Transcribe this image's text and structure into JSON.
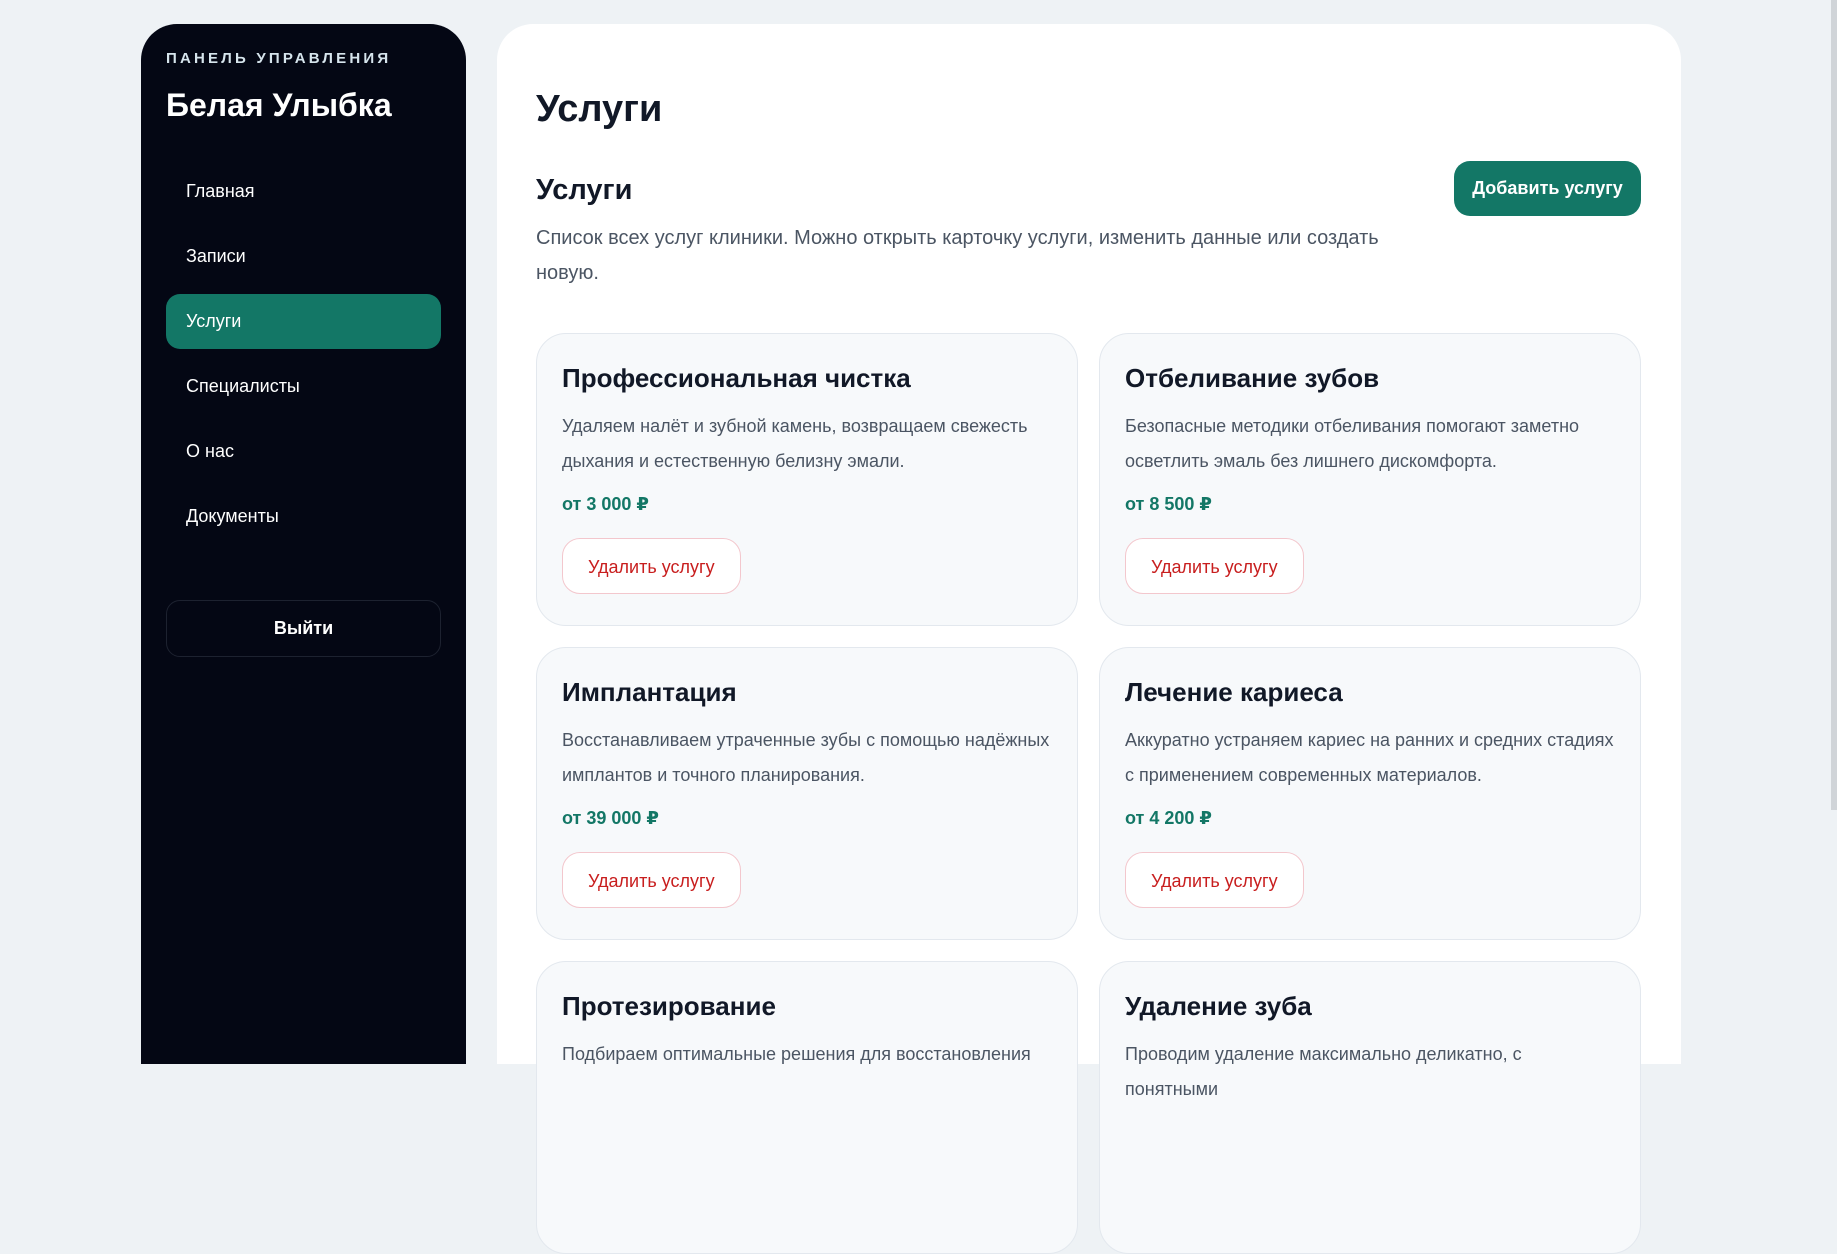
{
  "sidebar": {
    "kicker": "ПАНЕЛЬ УПРАВЛЕНИЯ",
    "brand": "Белая Улыбка",
    "items": [
      {
        "label": "Главная",
        "active": false
      },
      {
        "label": "Записи",
        "active": false
      },
      {
        "label": "Услуги",
        "active": true
      },
      {
        "label": "Специалисты",
        "active": false
      },
      {
        "label": "О нас",
        "active": false
      },
      {
        "label": "Документы",
        "active": false
      }
    ],
    "logout_label": "Выйти"
  },
  "main": {
    "page_title": "Услуги",
    "section_title": "Услуги",
    "section_desc": "Список всех услуг клиники. Можно открыть карточку услуги, изменить данные или создать новую.",
    "add_button": "Добавить услугу"
  },
  "services": [
    {
      "title": "Профессиональная чистка",
      "desc": "Удаляем налёт и зубной камень, возвращаем свежесть дыхания и естественную белизну эмали.",
      "price": "от 3 000 ₽",
      "delete_label": "Удалить услугу"
    },
    {
      "title": "Отбеливание зубов",
      "desc": "Безопасные методики отбеливания помогают заметно осветлить эмаль без лишнего дискомфорта.",
      "price": "от 8 500 ₽",
      "delete_label": "Удалить услугу"
    },
    {
      "title": "Имплантация",
      "desc": "Восстанавливаем утраченные зубы с помощью надёжных имплантов и точного планирования.",
      "price": "от 39 000 ₽",
      "delete_label": "Удалить услугу"
    },
    {
      "title": "Лечение кариеса",
      "desc": "Аккуратно устраняем кариес на ранних и средних стадиях с применением современных материалов.",
      "price": "от 4 200 ₽",
      "delete_label": "Удалить услугу"
    },
    {
      "title": "Протезирование",
      "desc": "Подбираем оптимальные решения для восстановления",
      "price": "",
      "delete_label": ""
    },
    {
      "title": "Удаление зуба",
      "desc": "Проводим удаление максимально деликатно, с понятными",
      "price": "",
      "delete_label": ""
    }
  ],
  "colors": {
    "accent": "#137766",
    "sidebar_bg": "#040714",
    "danger": "#c81e1e",
    "page_bg": "#eef2f5"
  }
}
